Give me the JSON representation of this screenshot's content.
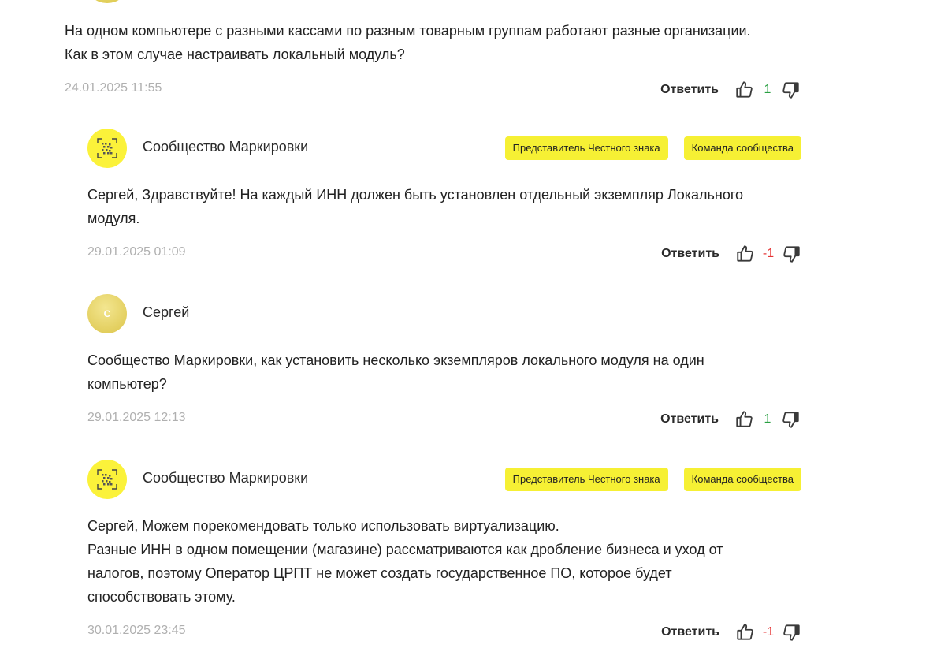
{
  "colors": {
    "badge_bg": "#f6f034",
    "date_text": "#b0b0b0",
    "score_positive": "#2aa043",
    "score_negative": "#e53535"
  },
  "comments": [
    {
      "author": "",
      "text_lines": [
        "На одном компьютере с разными кассами по разным товарным группам работают разные организации.",
        "Как в этом случае настраивать локальный модуль?"
      ],
      "date": "24.01.2025 11:55",
      "reply_label": "Ответить",
      "score": "1",
      "upvote_icon": "thumb-up-icon",
      "downvote_icon": "thumb-down-icon"
    },
    {
      "author": "Сообщество Маркировки",
      "avatar_icon": "datamatrix-logo-icon",
      "badges": [
        "Представитель Честного знака",
        "Команда сообщества"
      ],
      "text_lines": [
        "Сергей, Здравствуйте! На каждый ИНН должен быть установлен отдельный экземпляр Локального",
        "модуля."
      ],
      "date": "29.01.2025 01:09",
      "reply_label": "Ответить",
      "score": "-1"
    },
    {
      "author": "Сергей",
      "avatar_letter": "С",
      "text_lines": [
        "Сообщество Маркировки, как установить несколько экземпляров локального модуля на один",
        "компьютер?"
      ],
      "date": "29.01.2025 12:13",
      "reply_label": "Ответить",
      "score": "1"
    },
    {
      "author": "Сообщество Маркировки",
      "avatar_icon": "datamatrix-logo-icon",
      "badges": [
        "Представитель Честного знака",
        "Команда сообщества"
      ],
      "text_lines": [
        "Сергей, Можем порекомендовать только использовать виртуализацию.",
        "Разные ИНН в одном помещении (магазине) рассматриваются как дробление бизнеса и уход от",
        "налогов, поэтому Оператор ЦРПТ не может создать государственное ПО, которое будет",
        "способствовать этому."
      ],
      "date": "30.01.2025 23:45",
      "reply_label": "Ответить",
      "score": "-1"
    }
  ]
}
